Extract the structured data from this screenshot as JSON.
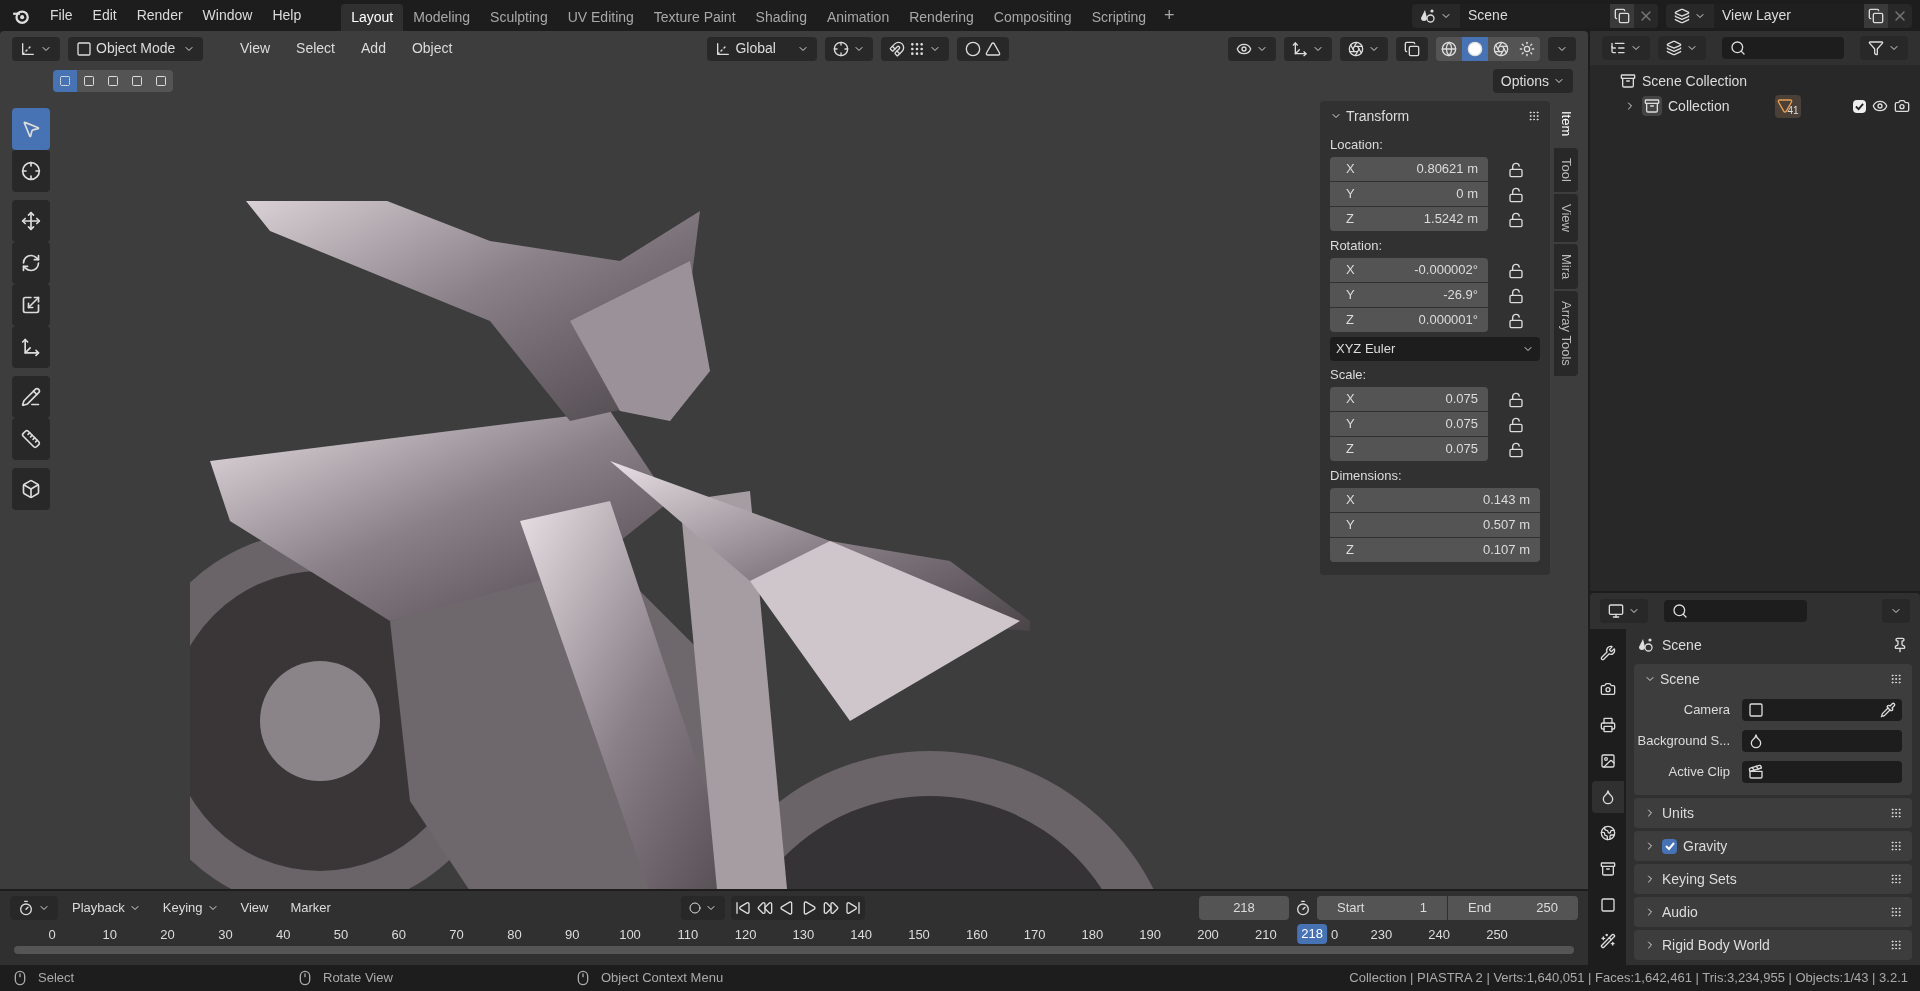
{
  "menu_bar": {
    "items": [
      "File",
      "Edit",
      "Render",
      "Window",
      "Help"
    ]
  },
  "workspace_tabs": [
    {
      "label": "Layout",
      "selected": true
    },
    {
      "label": "Modeling",
      "selected": false
    },
    {
      "label": "Sculpting",
      "selected": false
    },
    {
      "label": "UV Editing",
      "selected": false
    },
    {
      "label": "Texture Paint",
      "selected": false
    },
    {
      "label": "Shading",
      "selected": false
    },
    {
      "label": "Animation",
      "selected": false
    },
    {
      "label": "Rendering",
      "selected": false
    },
    {
      "label": "Compositing",
      "selected": false
    },
    {
      "label": "Scripting",
      "selected": false
    }
  ],
  "add_workspace": "+",
  "scene_selector": {
    "value": "Scene"
  },
  "view_layer_selector": {
    "value": "View Layer"
  },
  "viewport": {
    "mode": "Object Mode",
    "menus": [
      "View",
      "Select",
      "Add",
      "Object"
    ],
    "orientation": "Global",
    "options": "Options",
    "shading_modes": [
      {
        "selected": false
      },
      {
        "selected": true
      },
      {
        "selected": false
      },
      {
        "selected": false
      }
    ],
    "select_modes": [
      {
        "selected": true
      },
      {
        "selected": false
      },
      {
        "selected": false
      },
      {
        "selected": false
      },
      {
        "selected": false
      }
    ],
    "tools": [
      {
        "selected": true
      },
      {
        "selected": false
      },
      {
        "selected": false
      },
      {
        "selected": false
      },
      {
        "selected": false
      },
      {
        "selected": false
      },
      {
        "selected": false
      },
      {
        "selected": false
      },
      {
        "selected": false
      }
    ]
  },
  "sidebar": {
    "panel_title": "Transform",
    "groups": [
      {
        "label": "Location:",
        "rows": [
          {
            "axis": "X",
            "value": "0.80621 m",
            "locked": false
          },
          {
            "axis": "Y",
            "value": "0 m",
            "locked": false
          },
          {
            "axis": "Z",
            "value": "1.5242 m",
            "locked": false
          }
        ]
      },
      {
        "label": "Rotation:",
        "rows": [
          {
            "axis": "X",
            "value": "-0.000002°",
            "locked": false
          },
          {
            "axis": "Y",
            "value": "-26.9°",
            "locked": false
          },
          {
            "axis": "Z",
            "value": "0.000001°",
            "locked": false
          }
        ],
        "mode": "XYZ Euler"
      },
      {
        "label": "Scale:",
        "rows": [
          {
            "axis": "X",
            "value": "0.075",
            "locked": false
          },
          {
            "axis": "Y",
            "value": "0.075",
            "locked": false
          },
          {
            "axis": "Z",
            "value": "0.075",
            "locked": false
          }
        ]
      },
      {
        "label": "Dimensions:",
        "rows": [
          {
            "axis": "X",
            "value": "0.143 m"
          },
          {
            "axis": "Y",
            "value": "0.507 m"
          },
          {
            "axis": "Z",
            "value": "0.107 m"
          }
        ]
      }
    ],
    "tabs": [
      {
        "label": "Item",
        "selected": true
      },
      {
        "label": "Tool",
        "selected": false
      },
      {
        "label": "View",
        "selected": false
      },
      {
        "label": "Mira",
        "selected": false
      },
      {
        "label": "Array Tools",
        "selected": false
      }
    ]
  },
  "outliner": {
    "items": [
      {
        "label": "Scene Collection",
        "children": [
          {
            "label": "Collection",
            "expanded": false,
            "badge": "41",
            "checked": true
          }
        ]
      }
    ]
  },
  "properties": {
    "title": "Scene",
    "tabs": [
      {
        "selected": false
      },
      {
        "selected": false
      },
      {
        "selected": false
      },
      {
        "selected": false
      },
      {
        "selected": true
      },
      {
        "selected": false
      },
      {
        "selected": false
      },
      {
        "selected": false
      },
      {
        "selected": false
      }
    ],
    "scene_panel": {
      "title": "Scene",
      "expanded": true,
      "fields": [
        {
          "label": "Camera"
        },
        {
          "label": "Background S..."
        },
        {
          "label": "Active Clip"
        }
      ]
    },
    "panels": [
      {
        "title": "Units",
        "expanded": false
      },
      {
        "title": "Gravity",
        "expanded": false,
        "checkbox": {
          "checked": true
        }
      },
      {
        "title": "Keying Sets",
        "expanded": false
      },
      {
        "title": "Audio",
        "expanded": false
      },
      {
        "title": "Rigid Body World",
        "expanded": false
      }
    ]
  },
  "timeline": {
    "menus": [
      "Playback",
      "Keying",
      "View",
      "Marker"
    ],
    "current_frame": "218",
    "start_label": "Start",
    "start": "1",
    "end_label": "End",
    "end": "250",
    "ruler_before": [
      "0",
      "10",
      "20",
      "30",
      "40",
      "50",
      "60",
      "70",
      "80",
      "90",
      "100",
      "110",
      "120",
      "130",
      "140",
      "150",
      "160",
      "170",
      "180",
      "190",
      "200",
      "210"
    ],
    "ruler_fragment": "0",
    "ruler_after": [
      "230",
      "240",
      "250"
    ],
    "playhead": {
      "label": "218",
      "level": 0.872
    }
  },
  "status_bar": {
    "hints": [
      {
        "label": "Select"
      },
      {
        "label": "Rotate View"
      },
      {
        "label": "Object Context Menu"
      }
    ],
    "stats": "Collection | PIASTRA 2 | Verts:1,640,051 | Faces:1,642,461 | Tris:3,234,955 | Objects:1/43 | 3.2.1"
  }
}
